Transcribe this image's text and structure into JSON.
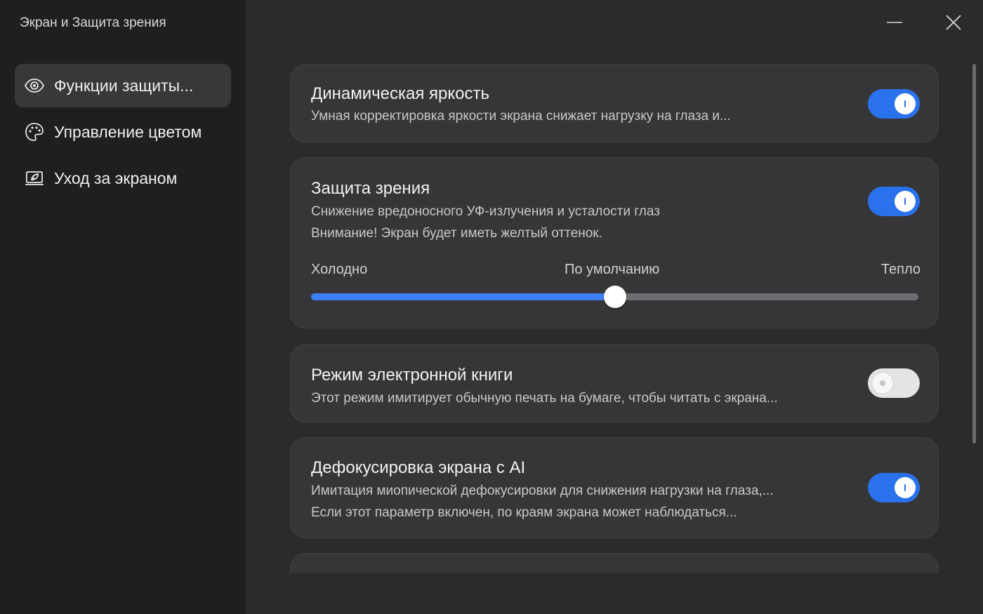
{
  "window": {
    "title": "Экран и Защита зрения",
    "minimize_icon": "minimize-icon",
    "close_icon": "close-icon"
  },
  "sidebar": {
    "items": [
      {
        "label": "Функции защиты...",
        "icon": "eye-icon",
        "active": true
      },
      {
        "label": "Управление цветом",
        "icon": "palette-icon",
        "active": false
      },
      {
        "label": "Уход за экраном",
        "icon": "laptop-leaf-icon",
        "active": false
      }
    ]
  },
  "cards": {
    "dynamic_brightness": {
      "title": "Динамическая яркость",
      "desc": "Умная корректировка яркости экрана снижает нагрузку на глаза и...",
      "enabled": true
    },
    "eye_protection": {
      "title": "Защита зрения",
      "desc1": "Снижение вредоносного УФ-излучения и усталости глаз",
      "desc2": "Внимание! Экран будет иметь желтый оттенок.",
      "enabled": true,
      "slider": {
        "label_cold": "Холодно",
        "label_default": "По умолчанию",
        "label_warm": "Тепло",
        "value": 0.5
      }
    },
    "ebook_mode": {
      "title": "Режим электронной книги",
      "desc": "Этот режим имитирует обычную печать на бумаге, чтобы читать с экрана...",
      "enabled": false
    },
    "ai_defocus": {
      "title": "Дефокусировка экрана с AI",
      "desc1": "Имитация миопической дефокусировки для снижения нагрузки на глаза,...",
      "desc2": "Если этот параметр включен, по краям экрана может наблюдаться...",
      "enabled": true
    }
  },
  "colors": {
    "accent": "#2a72ec",
    "sidebar_bg": "#1f1f21",
    "main_bg": "#2b2b2d",
    "card_bg": "#363638"
  }
}
